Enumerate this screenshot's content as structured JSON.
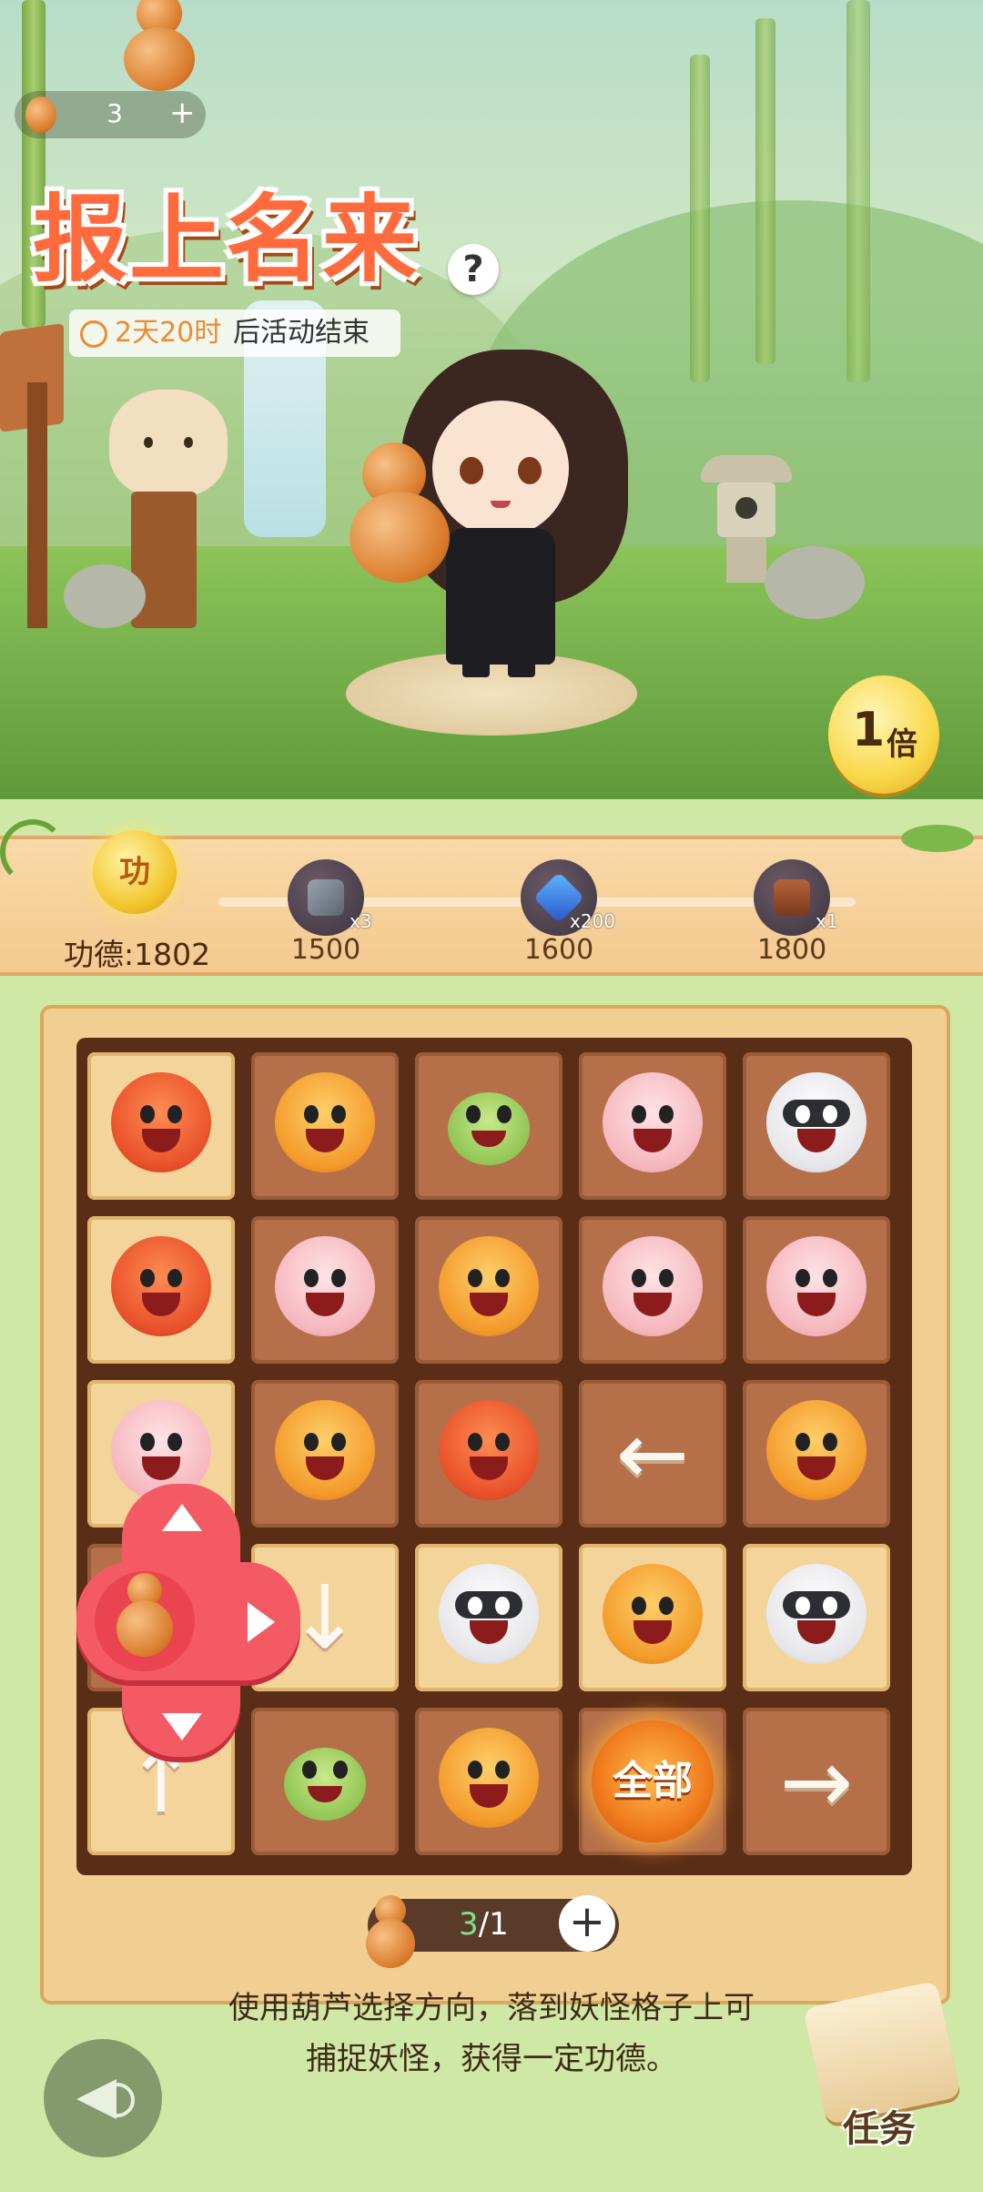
{
  "currency": {
    "amount": "3",
    "plus": "+"
  },
  "event": {
    "title": "报上名来",
    "help": "?",
    "timer_value": "2天20时",
    "timer_suffix": "后活动结束"
  },
  "multiplier": {
    "num": "1",
    "unit": "倍"
  },
  "merit": {
    "coin_label": "功",
    "label": "功德:1802",
    "milestones": [
      {
        "count": "x3",
        "threshold": "1500",
        "icon": "sword-icon"
      },
      {
        "count": "x200",
        "threshold": "1600",
        "icon": "gem-icon"
      },
      {
        "count": "x1",
        "threshold": "1800",
        "icon": "chest-icon"
      }
    ]
  },
  "board": {
    "rows": [
      [
        "dragon",
        "tiger",
        "frog",
        "pig",
        "raccoon"
      ],
      [
        "dragon",
        "pig",
        "tiger",
        "pig",
        "pig"
      ],
      [
        "pig",
        "tiger",
        "dragon",
        "arrow-left",
        "tiger"
      ],
      [
        "empty",
        "arrow-down",
        "raccoon",
        "tiger",
        "raccoon"
      ],
      [
        "arrow-up",
        "frog",
        "tiger",
        "all",
        "arrow-right"
      ]
    ],
    "all_label": "全部",
    "arrow_glyphs": {
      "arrow-left": "←",
      "arrow-right": "→",
      "arrow-up": "↑",
      "arrow-down": "↓"
    }
  },
  "gourd_counter": {
    "current": "3",
    "separator": "/",
    "total": "1",
    "plus": "+"
  },
  "instructions": {
    "line1": "使用葫芦选择方向，落到妖怪格子上可",
    "line2": "捕捉妖怪，获得一定功德。"
  },
  "task": {
    "label": "任务"
  },
  "colors": {
    "accent": "#f45a64",
    "timer": "#f08a2c",
    "brand": "#ff6b3d"
  }
}
